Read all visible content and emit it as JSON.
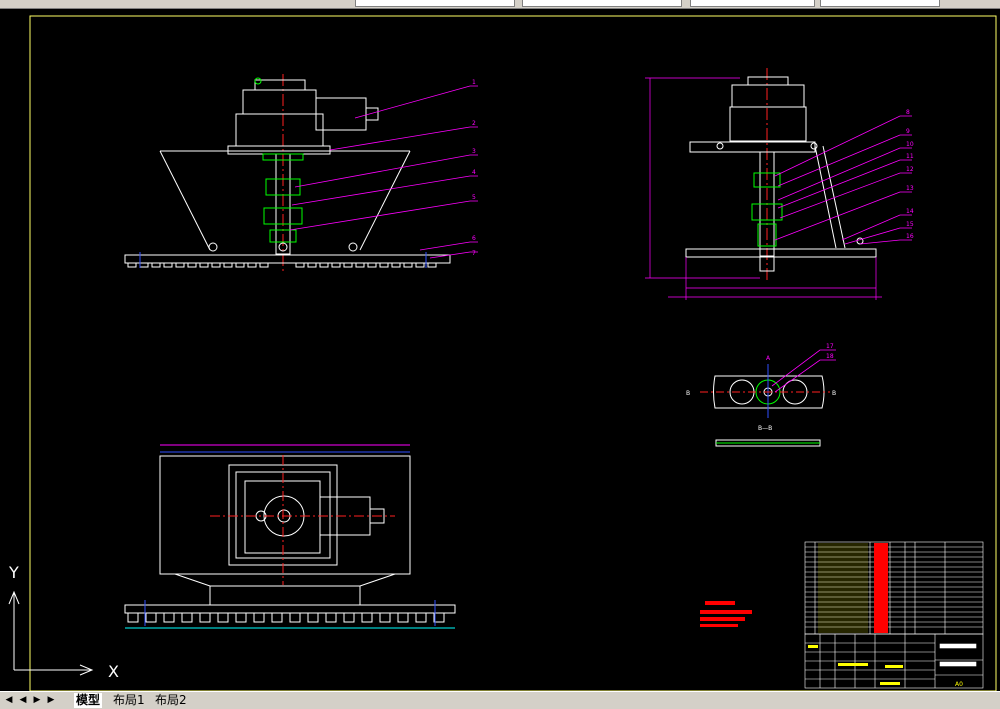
{
  "ui": {
    "tabs": [
      {
        "label": "模型"
      },
      {
        "label": "布局1"
      },
      {
        "label": "布局2"
      }
    ],
    "nav": {
      "first": "◀",
      "prev": "◀",
      "next": "▶",
      "last": "▶"
    },
    "ucs": {
      "x": "X",
      "y": "Y"
    }
  },
  "drawing": {
    "callouts": [
      "1",
      "2",
      "3",
      "4",
      "5",
      "6",
      "7",
      "8",
      "9",
      "10",
      "11",
      "12",
      "13",
      "14",
      "15",
      "16",
      "17",
      "18"
    ],
    "section_marks": {
      "a_top": "A",
      "b_left": "B",
      "b_right": "B",
      "section_title": "B—B"
    },
    "titleblock_code": "A0"
  },
  "colors": {
    "background": "#000000",
    "frame": "#ffff66",
    "lines": "#ffffff",
    "leader": "#ff00ff",
    "centerline": "#ff2020",
    "part_green": "#00ff00",
    "dimension_blue": "#3050ff",
    "table_red": "#ff0000"
  }
}
